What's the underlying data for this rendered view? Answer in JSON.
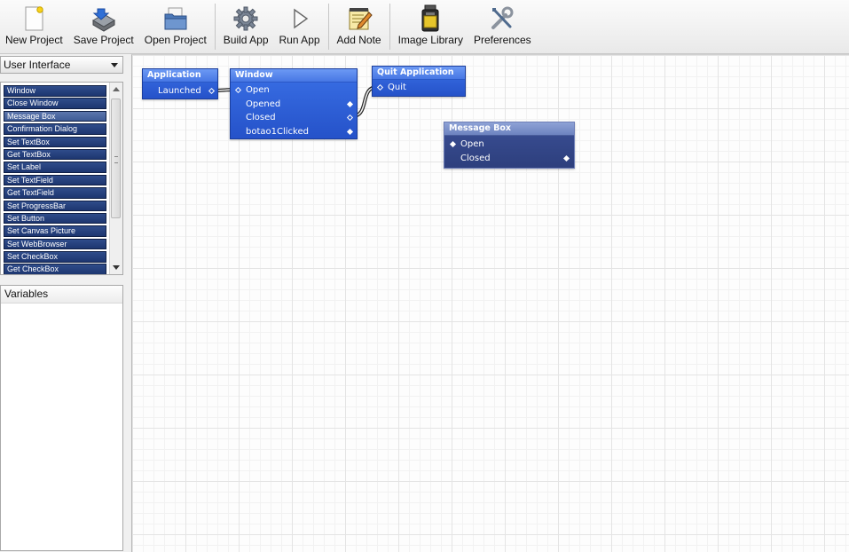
{
  "toolbar": {
    "new_project": "New Project",
    "save_project": "Save Project",
    "open_project": "Open Project",
    "build_app": "Build App",
    "run_app": "Run App",
    "add_note": "Add Note",
    "image_library": "Image Library",
    "preferences": "Preferences"
  },
  "sidebar": {
    "category": "User Interface",
    "items": [
      "Window",
      "Close Window",
      "Message Box",
      "Confirmation Dialog",
      "Set TextBox",
      "Get TextBox",
      "Set Label",
      "Set TextField",
      "Get TextField",
      "Set ProgressBar",
      "Set Button",
      "Set Canvas Picture",
      "Set WebBrowser",
      "Set CheckBox",
      "Get CheckBox"
    ],
    "selected_item": "Message Box",
    "variables_header": "Variables"
  },
  "nodes": {
    "application": {
      "title": "Application",
      "launched": "Launched"
    },
    "window": {
      "title": "Window",
      "open": "Open",
      "opened": "Opened",
      "closed": "Closed",
      "clicked": "botao1Clicked"
    },
    "quit": {
      "title": "Quit Application",
      "quit": "Quit"
    },
    "message_box": {
      "title": "Message Box",
      "open": "Open",
      "closed": "Closed"
    }
  },
  "colors": {
    "node_blue": "#2f5fd8",
    "node_dark": "#33468a",
    "list_item": "#243d7a"
  }
}
